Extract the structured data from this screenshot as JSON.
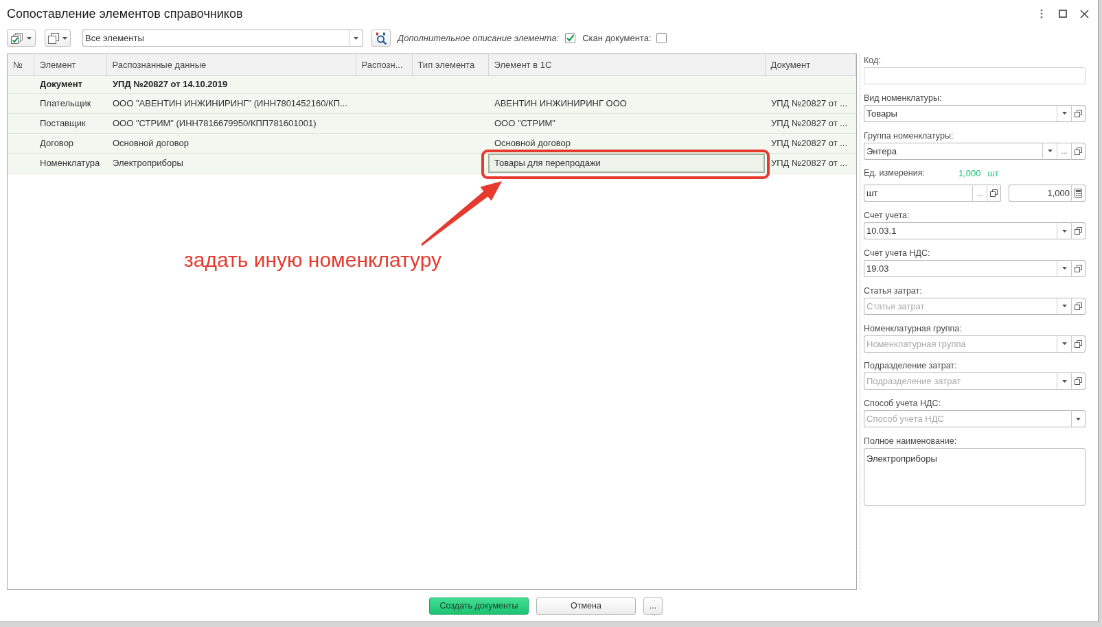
{
  "window": {
    "title": "Сопоставление элементов справочников"
  },
  "toolbar": {
    "filter": {
      "value": "Все элементы"
    },
    "options": [
      {
        "label": "Дополнительное описание элемента:",
        "italic": true,
        "checked": true
      },
      {
        "label": "Скан документа:",
        "italic": false,
        "checked": false
      }
    ]
  },
  "table": {
    "columns": [
      "№",
      "Элемент",
      "Распознанные данные",
      "Распозн...",
      "Тип элемента",
      "Элемент в 1С",
      "Документ"
    ],
    "rows": [
      {
        "kind": "document",
        "element": "Документ",
        "recognized": "УПД №20827 от 14.10.2019",
        "selected": false
      },
      {
        "kind": "item",
        "element": "Плательщик",
        "recognized": "ООО \"АВЕНТИН ИНЖИНИРИНГ\" (ИНН7801452160/КП...",
        "element_1c": "АВЕНТИН ИНЖИНИРИНГ ООО",
        "document": "УПД №20827 от ...",
        "selected": false
      },
      {
        "kind": "item",
        "element": "Поставщик",
        "recognized": "ООО \"СТРИМ\" (ИНН7816679950/КПП781601001)",
        "element_1c": "ООО \"СТРИМ\"",
        "document": "УПД №20827 от ...",
        "selected": false
      },
      {
        "kind": "item",
        "element": "Договор",
        "recognized": "Основной договор",
        "element_1c": "Основной договор",
        "document": "УПД №20827 от ...",
        "selected": false
      },
      {
        "kind": "item",
        "element": "Номенклатура",
        "recognized": "Электроприборы",
        "element_1c": "Товары для перепродажи",
        "document": "УПД №20827 от ...",
        "selected": true
      }
    ]
  },
  "annotation": {
    "text": "задать иную номенклатуру"
  },
  "panel": {
    "fields": [
      {
        "kind": "text",
        "label": "Код:"
      },
      {
        "kind": "combo",
        "label": "Вид номенклатуры:",
        "value": "Товары",
        "dropdown": true,
        "open": true
      },
      {
        "kind": "combo",
        "label": "Группа номенклатуры:",
        "value": "Энтера",
        "dropdown": true,
        "choice": "...",
        "open": true
      },
      {
        "kind": "unit",
        "label": "Ед. измерения:",
        "ratio": "1,000",
        "ratio_unit": "шт",
        "unit": {
          "value": "шт",
          "choice": "...",
          "open": true
        },
        "quantity": {
          "value": "1,000",
          "calculator": true
        }
      },
      {
        "kind": "combo",
        "label": "Счет учета:",
        "value": "10.03.1",
        "dropdown": true,
        "open": true
      },
      {
        "kind": "combo",
        "label": "Счет учета НДС:",
        "value": "19.03",
        "dropdown": true,
        "open": true
      },
      {
        "kind": "combo",
        "label": "Статья затрат:",
        "placeholder": "Статья затрат",
        "dropdown": true,
        "open": true
      },
      {
        "kind": "combo",
        "label": "Номенклатурная группа:",
        "placeholder": "Номенклатурная группа",
        "dropdown": true,
        "open": true
      },
      {
        "kind": "combo",
        "label": "Подразделение затрат:",
        "placeholder": "Подразделение затрат",
        "dropdown": true,
        "open": true
      },
      {
        "kind": "combo",
        "label": "Способ учета НДС:",
        "placeholder": "Способ учета НДС",
        "dropdown": true
      },
      {
        "kind": "memo",
        "label": "Полное наименование:",
        "value": "Электроприборы"
      }
    ]
  },
  "footer": {
    "buttons": [
      {
        "label": "Создать документы",
        "default": true
      },
      {
        "label": "Отмена",
        "default": false
      },
      {
        "label": "...",
        "default": false
      }
    ]
  }
}
